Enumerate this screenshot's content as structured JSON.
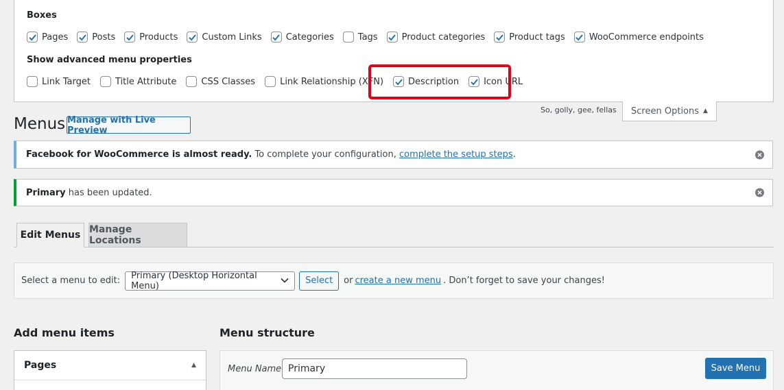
{
  "screen_options": {
    "boxes_title": "Boxes",
    "boxes": [
      {
        "label": "Pages",
        "checked": true
      },
      {
        "label": "Posts",
        "checked": true
      },
      {
        "label": "Products",
        "checked": true
      },
      {
        "label": "Custom Links",
        "checked": true
      },
      {
        "label": "Categories",
        "checked": true
      },
      {
        "label": "Tags",
        "checked": false
      },
      {
        "label": "Product categories",
        "checked": true
      },
      {
        "label": "Product tags",
        "checked": true
      },
      {
        "label": "WooCommerce endpoints",
        "checked": true
      }
    ],
    "advanced_title": "Show advanced menu properties",
    "advanced": [
      {
        "label": "Link Target",
        "checked": false
      },
      {
        "label": "Title Attribute",
        "checked": false
      },
      {
        "label": "CSS Classes",
        "checked": false
      },
      {
        "label": "Link Relationship (XFN)",
        "checked": false
      },
      {
        "label": "Description",
        "checked": true
      },
      {
        "label": "Icon URL",
        "checked": true
      }
    ],
    "tab_label": "Screen Options",
    "tagline": "So, golly, gee, fellas"
  },
  "header": {
    "title": "Menus",
    "live_preview_label": "Manage with Live Preview"
  },
  "notices": {
    "facebook": {
      "bold": "Facebook for WooCommerce is almost ready.",
      "text": "To complete your configuration,",
      "link": "complete the setup steps",
      "end": "."
    },
    "updated": {
      "bold": "Primary",
      "text": "has been updated."
    }
  },
  "tabs": {
    "edit": "Edit Menus",
    "manage": "Manage Locations"
  },
  "select_bar": {
    "label": "Select a menu to edit:",
    "selected": "Primary (Desktop Horizontal Menu)",
    "button": "Select",
    "or": "or",
    "create_link": "create a new menu",
    "tail": ". Don’t forget to save your changes!"
  },
  "add_items": {
    "title": "Add menu items",
    "pages_label": "Pages"
  },
  "structure": {
    "title": "Menu structure",
    "name_label": "Menu Name",
    "name_value": "Primary",
    "save_label": "Save Menu"
  },
  "colors": {
    "accent": "#2271b1",
    "highlight": "#e0001a",
    "notice_info": "#72aee6",
    "notice_success": "#00a32a"
  }
}
